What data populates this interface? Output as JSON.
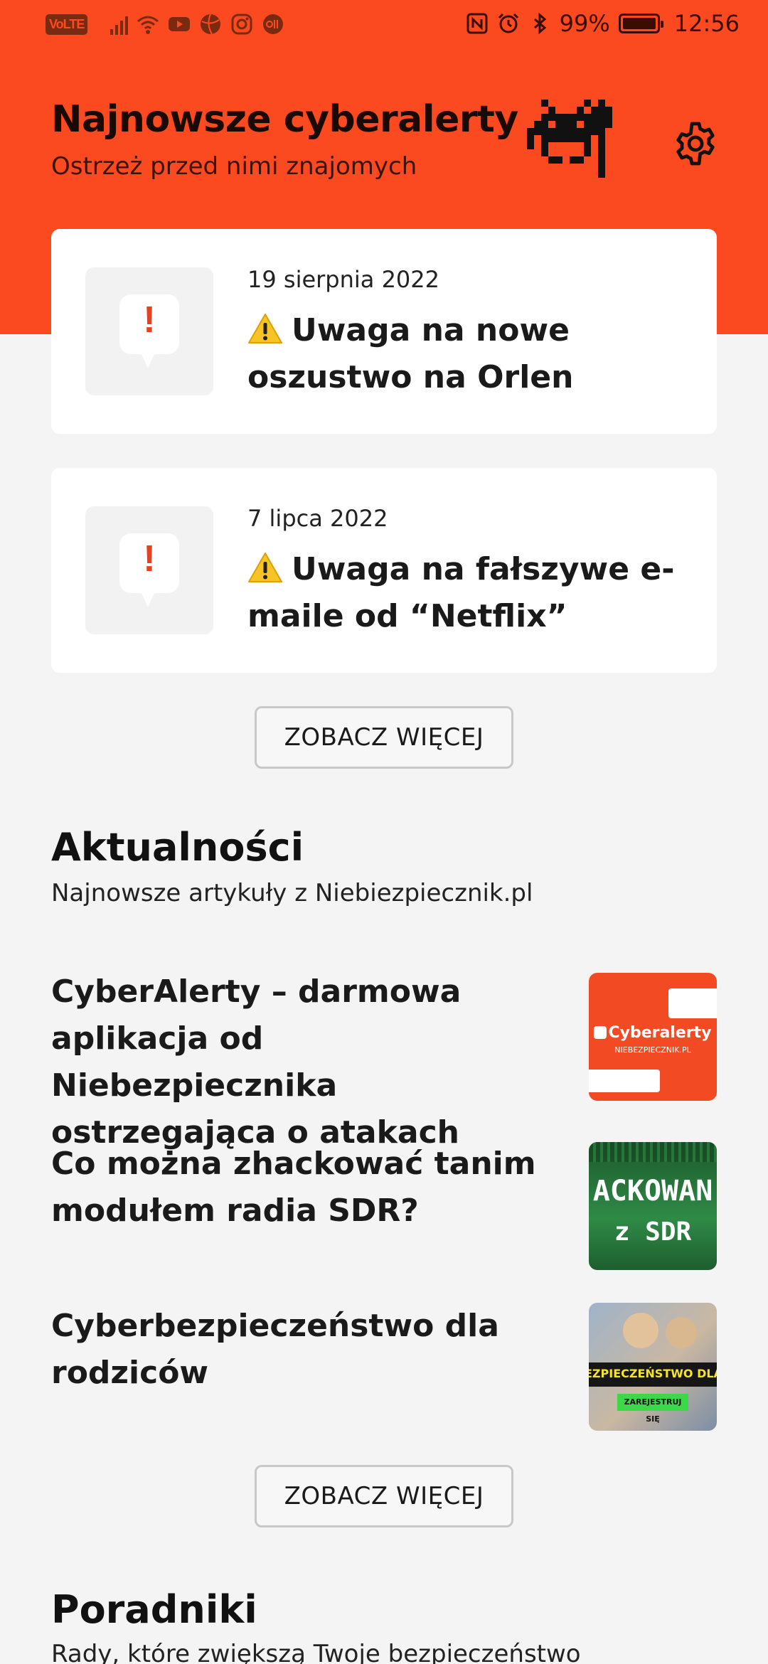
{
  "status_bar": {
    "volte": "VoLTE",
    "battery_percent": "99%",
    "time": "12:56"
  },
  "header": {
    "title": "Najnowsze cyberalerty",
    "subtitle": "Ostrzeż przed nimi znajomych"
  },
  "alerts": [
    {
      "date": "19 sierpnia 2022",
      "title": "Uwaga na nowe oszustwo na Orlen"
    },
    {
      "date": "7 lipca 2022",
      "title": "Uwaga na fałszywe e-maile od “Netflix”"
    }
  ],
  "buttons": {
    "more_alerts": "ZOBACZ WIĘCEJ",
    "more_news": "ZOBACZ WIĘCEJ"
  },
  "news": {
    "title": "Aktualności",
    "subtitle": "Najnowsze artykuły z Niebiezpiecznik.pl",
    "items": [
      {
        "title": "CyberAlerty – darmowa aplikacja od Niebezpiecznika ostrzegająca o atakach",
        "thumb_text": "Cyberalerty",
        "thumb_subtext": "NIEBEZPIECZNIK.PL"
      },
      {
        "title": "Co można zhackować tanim modułem radia SDR?",
        "thumb_text": "ACKOWAN",
        "thumb_subtext": "z SDR"
      },
      {
        "title": "Cyberbezpieczeństwo dla rodziców",
        "thumb_text": "EZPIECZEŃSTWO DLA RO",
        "thumb_subtext": "ZAREJESTRUJ SIĘ"
      }
    ]
  },
  "guides": {
    "title": "Poradniki",
    "subtitle": "Rady, które zwiększą Twoje bezpieczeństwo"
  },
  "colors": {
    "brand": "#fb4a1f",
    "background": "#f4f4f4",
    "card": "#ffffff"
  },
  "icons": [
    "signal-icon",
    "wifi-icon",
    "youtube-icon",
    "basketball-icon",
    "instagram-icon",
    "app-icon",
    "nfc-icon",
    "alarm-icon",
    "bluetooth-icon",
    "battery-icon",
    "invader-logo",
    "gear-icon",
    "speech-bubble-icon",
    "warning-icon"
  ]
}
